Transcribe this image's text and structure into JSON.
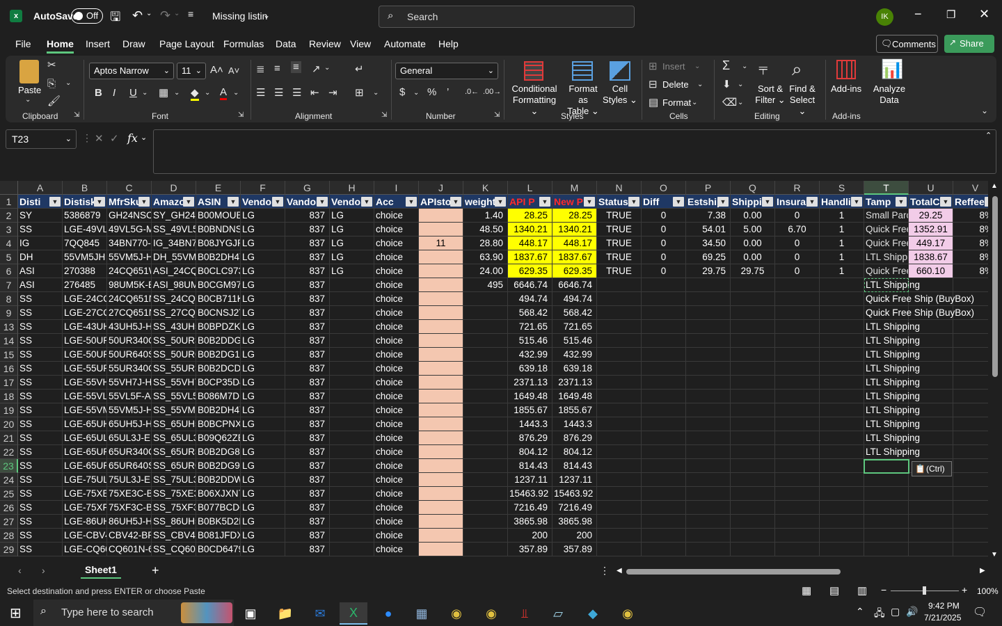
{
  "titlebar": {
    "autosave_label": "AutoSave",
    "autosave_state": "Off",
    "filename": "Missing listin",
    "search_placeholder": "Search",
    "avatar": "IK"
  },
  "menu": {
    "tabs": [
      "File",
      "Home",
      "Insert",
      "Draw",
      "Page Layout",
      "Formulas",
      "Data",
      "Review",
      "View",
      "Automate",
      "Help"
    ],
    "comments": "Comments",
    "share": "Share"
  },
  "ribbon": {
    "clipboard": {
      "paste": "Paste",
      "label": "Clipboard"
    },
    "font": {
      "name": "Aptos Narrow",
      "size": "11",
      "label": "Font"
    },
    "alignment": {
      "label": "Alignment"
    },
    "number": {
      "format": "General",
      "label": "Number"
    },
    "styles": {
      "conditional": "Conditional",
      "conditional2": "Formatting",
      "format_as": "Format as",
      "format_as2": "Table",
      "cell_styles": "Cell",
      "cell_styles2": "Styles",
      "label": "Styles"
    },
    "cells": {
      "insert": "Insert",
      "delete": "Delete",
      "format": "Format",
      "label": "Cells"
    },
    "editing": {
      "sort": "Sort &",
      "sort2": "Filter",
      "find": "Find &",
      "find2": "Select",
      "label": "Editing"
    },
    "addins": {
      "addins": "Add-ins",
      "analyze": "Analyze",
      "analyze2": "Data",
      "label": "Add-ins"
    }
  },
  "formula": {
    "namebox": "T23",
    "content": ""
  },
  "columns": [
    "A",
    "B",
    "C",
    "D",
    "E",
    "F",
    "G",
    "H",
    "I",
    "J",
    "K",
    "L",
    "M",
    "N",
    "O",
    "P",
    "Q",
    "R",
    "S",
    "T",
    "U",
    "V"
  ],
  "headers": [
    "Disti",
    "Distisk",
    "MfrSku",
    "Amazo",
    "ASIN",
    "Vendor",
    "Vandor",
    "Vendor",
    "Acc",
    "APIsto",
    "weight",
    "API P",
    "New P",
    "Status",
    "Diff",
    "Estship",
    "Shippin",
    "Insuran",
    "Handlin",
    "Tamp",
    "TotalC",
    "Reffee"
  ],
  "row_numbers": [
    "1",
    "2",
    "3",
    "4",
    "5",
    "6",
    "7",
    "8",
    "9",
    "13",
    "14",
    "15",
    "16",
    "17",
    "18",
    "19",
    "20",
    "21",
    "22",
    "23",
    "24",
    "25",
    "26",
    "27",
    "28",
    "29"
  ],
  "rows": [
    [
      "SY",
      "5386879",
      "GH24NSC0",
      "SY_GH24N",
      "B00MOUB",
      "LG",
      "837",
      "LG",
      "choice",
      "",
      "1.40",
      "28.25",
      "28.25",
      "TRUE",
      "0",
      "7.38",
      "0.00",
      "0",
      "1",
      "Small Parc",
      "29.25",
      "8%"
    ],
    [
      "SS",
      "LGE-49VL5",
      "49VL5G-M",
      "SS_49VL5",
      "B0BNDNS",
      "LG",
      "837",
      "LG",
      "choice",
      "",
      "48.50",
      "1340.21",
      "1340.21",
      "TRUE",
      "0",
      "54.01",
      "5.00",
      "6.70",
      "1",
      "Quick Free",
      "1352.91",
      "8%"
    ],
    [
      "IG",
      "7QQ845",
      "34BN770-I",
      "IG_34BN77",
      "B08JYGJP3",
      "LG",
      "837",
      "LG",
      "choice",
      "11",
      "28.80",
      "448.17",
      "448.17",
      "TRUE",
      "0",
      "34.50",
      "0.00",
      "0",
      "1",
      "Quick Free",
      "449.17",
      "8%"
    ],
    [
      "DH",
      "55VM5JH",
      "55VM5J-H",
      "DH_55VM5",
      "B0B2DH4Y",
      "LG",
      "837",
      "LG",
      "choice",
      "",
      "63.90",
      "1837.67",
      "1837.67",
      "TRUE",
      "0",
      "69.25",
      "0.00",
      "0",
      "1",
      "LTL Shippi",
      "1838.67",
      "8%"
    ],
    [
      "ASI",
      "270388",
      "24CQ651W",
      "ASI_24CQ6",
      "B0CLC973I",
      "LG",
      "837",
      "LG",
      "choice",
      "",
      "24.00",
      "629.35",
      "629.35",
      "TRUE",
      "0",
      "29.75",
      "29.75",
      "0",
      "1",
      "Quick Free",
      "660.10",
      "8%"
    ],
    [
      "ASI",
      "276485",
      "98UM5K-B",
      "ASI_98UM5",
      "B0CGM97V",
      "LG",
      "837",
      "",
      "choice",
      "",
      "495",
      "6646.74",
      "6646.74",
      "",
      "",
      "",
      "",
      "",
      "",
      "LTL Shipping",
      "",
      ""
    ],
    [
      "SS",
      "LGE-24CQ6",
      "24CQ651N",
      "SS_24CQ6",
      "B0CB711K",
      "LG",
      "837",
      "",
      "choice",
      "",
      "",
      "494.74",
      "494.74",
      "",
      "",
      "",
      "",
      "",
      "",
      "Quick Free Ship (BuyBox)",
      "",
      ""
    ],
    [
      "SS",
      "LGE-27CQ6",
      "27CQ651N",
      "SS_27CQ6",
      "B0CNSJ2T",
      "LG",
      "837",
      "",
      "choice",
      "",
      "",
      "568.42",
      "568.42",
      "",
      "",
      "",
      "",
      "",
      "",
      "Quick Free Ship (BuyBox)",
      "",
      ""
    ],
    [
      "SS",
      "LGE-43UH5",
      "43UH5J-H",
      "SS_43UH5",
      "B0BPDZKP",
      "LG",
      "837",
      "",
      "choice",
      "",
      "",
      "721.65",
      "721.65",
      "",
      "",
      "",
      "",
      "",
      "",
      "LTL Shipping",
      "",
      ""
    ],
    [
      "SS",
      "LGE-50UR3",
      "50UR340C",
      "SS_50UR34",
      "B0B2DDG1",
      "LG",
      "837",
      "",
      "choice",
      "",
      "",
      "515.46",
      "515.46",
      "",
      "",
      "",
      "",
      "",
      "",
      "LTL Shipping",
      "",
      ""
    ],
    [
      "SS",
      "LGE-50UR6",
      "50UR640S",
      "SS_50UR64",
      "B0B2DG1Z",
      "LG",
      "837",
      "",
      "choice",
      "",
      "",
      "432.99",
      "432.99",
      "",
      "",
      "",
      "",
      "",
      "",
      "LTL Shipping",
      "",
      ""
    ],
    [
      "SS",
      "LGE-55UR3",
      "55UR340C",
      "SS_55UR34",
      "B0B2DCDK",
      "LG",
      "837",
      "",
      "choice",
      "",
      "",
      "639.18",
      "639.18",
      "",
      "",
      "",
      "",
      "",
      "",
      "LTL Shipping",
      "",
      ""
    ],
    [
      "SS",
      "LGE-55VH7",
      "55VH7J-H",
      "SS_55VH7J",
      "B0CP35D4",
      "LG",
      "837",
      "",
      "choice",
      "",
      "",
      "2371.13",
      "2371.13",
      "",
      "",
      "",
      "",
      "",
      "",
      "LTL Shipping",
      "",
      ""
    ],
    [
      "SS",
      "LGE-55VL5",
      "55VL5F-A",
      "SS_55VL5F",
      "B086M7DN",
      "LG",
      "837",
      "",
      "choice",
      "",
      "",
      "1649.48",
      "1649.48",
      "",
      "",
      "",
      "",
      "",
      "",
      "LTL Shipping",
      "",
      ""
    ],
    [
      "SS",
      "LGE-55VM5",
      "55VM5J-H",
      "SS_55VM5",
      "B0B2DH4Y",
      "LG",
      "837",
      "",
      "choice",
      "",
      "",
      "1855.67",
      "1855.67",
      "",
      "",
      "",
      "",
      "",
      "",
      "LTL Shipping",
      "",
      ""
    ],
    [
      "SS",
      "LGE-65UH5",
      "65UH5J-H",
      "SS_65UH5",
      "B0BCPNXN",
      "LG",
      "837",
      "",
      "choice",
      "",
      "",
      "1443.3",
      "1443.3",
      "",
      "",
      "",
      "",
      "",
      "",
      "LTL Shipping",
      "",
      ""
    ],
    [
      "SS",
      "LGE-65UL3",
      "65UL3J-E",
      "SS_65UL3J",
      "B09Q62ZB",
      "LG",
      "837",
      "",
      "choice",
      "",
      "",
      "876.29",
      "876.29",
      "",
      "",
      "",
      "",
      "",
      "",
      "LTL Shipping",
      "",
      ""
    ],
    [
      "SS",
      "LGE-65UR3",
      "65UR340C",
      "SS_65UR34",
      "B0B2DG8F",
      "LG",
      "837",
      "",
      "choice",
      "",
      "",
      "804.12",
      "804.12",
      "",
      "",
      "",
      "",
      "",
      "",
      "LTL Shipping",
      "",
      ""
    ],
    [
      "SS",
      "LGE-65UR6",
      "65UR640S",
      "SS_65UR64",
      "B0B2DG97",
      "LG",
      "837",
      "",
      "choice",
      "",
      "",
      "814.43",
      "814.43",
      "",
      "",
      "",
      "",
      "",
      "",
      "",
      "",
      ""
    ],
    [
      "SS",
      "LGE-75UL3",
      "75UL3J-E",
      "SS_75UL3J",
      "B0B2DDW",
      "LG",
      "837",
      "",
      "choice",
      "",
      "",
      "1237.11",
      "1237.11",
      "",
      "",
      "",
      "",
      "",
      "",
      "",
      "",
      ""
    ],
    [
      "SS",
      "LGE-75XE3",
      "75XE3C-B",
      "SS_75XE3C",
      "B06XJXN7",
      "LG",
      "837",
      "",
      "choice",
      "",
      "",
      "15463.92",
      "15463.92",
      "",
      "",
      "",
      "",
      "",
      "",
      "",
      "",
      ""
    ],
    [
      "SS",
      "LGE-75XF3",
      "75XF3C-B",
      "SS_75XF3C",
      "B077BCDG",
      "LG",
      "837",
      "",
      "choice",
      "",
      "",
      "7216.49",
      "7216.49",
      "",
      "",
      "",
      "",
      "",
      "",
      "",
      "",
      ""
    ],
    [
      "SS",
      "LGE-86UH5",
      "86UH5J-H",
      "SS_86UH5",
      "B0BK5D2L",
      "LG",
      "837",
      "",
      "choice",
      "",
      "",
      "3865.98",
      "3865.98",
      "",
      "",
      "",
      "",
      "",
      "",
      "",
      "",
      ""
    ],
    [
      "SS",
      "LGE-CBV42",
      "CBV42-BP",
      "SS_CBV42-",
      "B081JFDXS",
      "LG",
      "837",
      "",
      "choice",
      "",
      "",
      "200",
      "200",
      "",
      "",
      "",
      "",
      "",
      "",
      "",
      "",
      ""
    ],
    [
      "SS",
      "LGE-CQ60",
      "CQ601N-6",
      "SS_CQ601",
      "B0CD6479",
      "LG",
      "837",
      "",
      "choice",
      "",
      "",
      "357.89",
      "357.89",
      "",
      "",
      "",
      "",
      "",
      "",
      "",
      "",
      ""
    ]
  ],
  "paste_options": "(Ctrl)",
  "sheet_tab": "Sheet1",
  "status": {
    "message": "Select destination and press ENTER or choose Paste",
    "zoom": "100%"
  },
  "taskbar": {
    "search": "Type here to search",
    "time": "9:42 PM",
    "date": "7/21/2025"
  }
}
